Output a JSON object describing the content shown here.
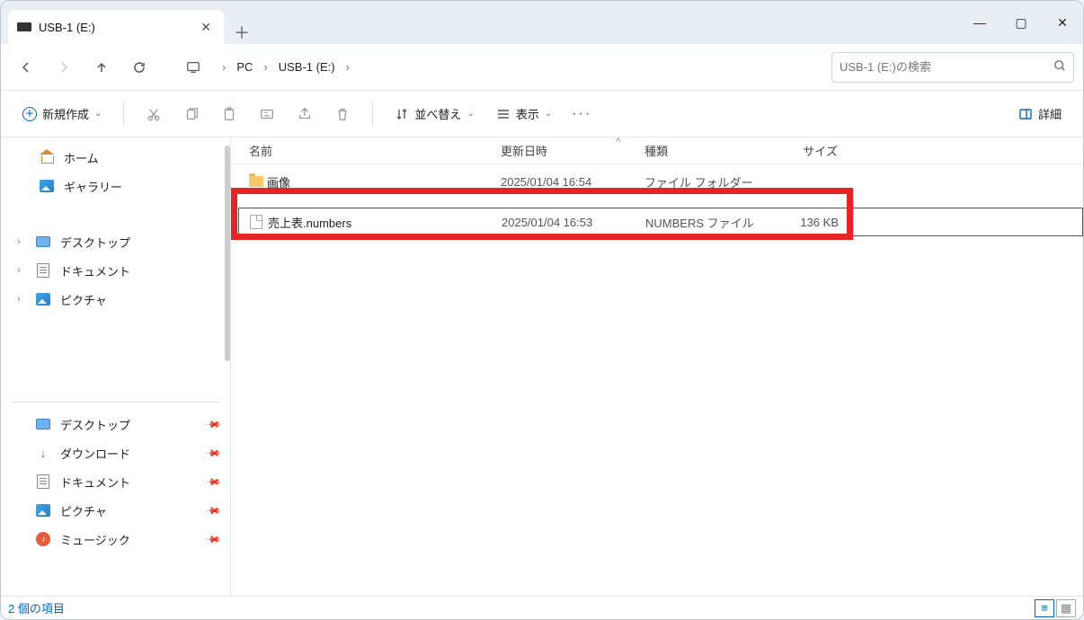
{
  "tab": {
    "title": "USB-1 (E:)"
  },
  "breadcrumb": {
    "pc": "PC",
    "drive": "USB-1 (E:)"
  },
  "search": {
    "placeholder": "USB-1 (E:)の検索"
  },
  "toolbar": {
    "new_label": "新規作成",
    "sort_label": "並べ替え",
    "view_label": "表示",
    "details_label": "詳細"
  },
  "sidebar": {
    "home": "ホーム",
    "gallery": "ギャラリー",
    "desktop": "デスクトップ",
    "documents": "ドキュメント",
    "pictures": "ピクチャ",
    "q_desktop": "デスクトップ",
    "q_downloads": "ダウンロード",
    "q_documents": "ドキュメント",
    "q_pictures": "ピクチャ",
    "q_music": "ミュージック"
  },
  "columns": {
    "name": "名前",
    "date": "更新日時",
    "type": "種類",
    "size": "サイズ"
  },
  "rows": [
    {
      "name": "画像",
      "date": "2025/01/04 16:54",
      "type": "ファイル フォルダー",
      "size": "",
      "kind": "folder"
    },
    {
      "name": "売上表.numbers",
      "date": "2025/01/04 16:53",
      "type": "NUMBERS ファイル",
      "size": "136 KB",
      "kind": "file"
    }
  ],
  "status": {
    "count": "2 個の項目"
  }
}
